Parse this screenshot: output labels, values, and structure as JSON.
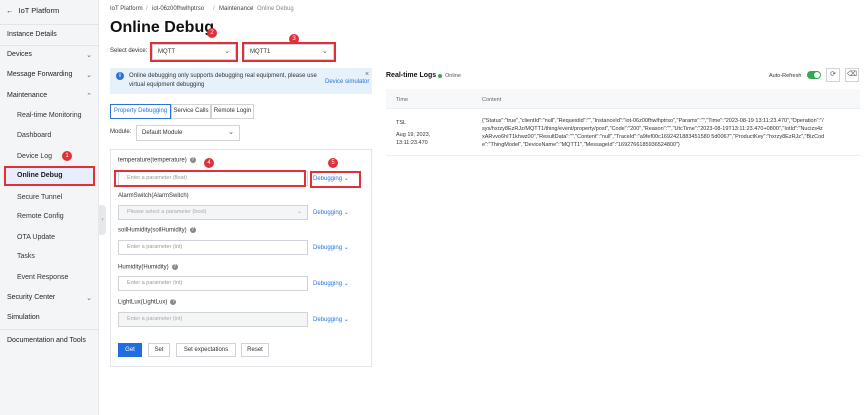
{
  "app": {
    "back_label": "IoT Platform"
  },
  "sidebar": {
    "items": [
      {
        "label": "Instance Details"
      },
      {
        "label": "Devices"
      },
      {
        "label": "Message Forwarding"
      },
      {
        "label": "Maintenance"
      },
      {
        "label": "Real-time Monitoring"
      },
      {
        "label": "Dashboard"
      },
      {
        "label": "Device Log"
      },
      {
        "label": "Online Debug"
      },
      {
        "label": "Secure Tunnel"
      },
      {
        "label": "Remote Config"
      },
      {
        "label": "OTA Update"
      },
      {
        "label": "Tasks"
      },
      {
        "label": "Event Response"
      },
      {
        "label": "Security Center"
      },
      {
        "label": "Simulation"
      },
      {
        "label": "Documentation and Tools"
      }
    ]
  },
  "breadcrumb": {
    "items": [
      "IoT Platform",
      "iot-06z00fhwlhptrso",
      "Maintenance",
      "Online Debug"
    ],
    "separator": "/"
  },
  "page": {
    "title": "Online Debug"
  },
  "device_select": {
    "label": "Select device:",
    "product": "MQTT",
    "device": "MQTT1"
  },
  "banner": {
    "message": "Online debugging only supports debugging real equipment, please use virtual equipment debugging",
    "link": "Device simulator"
  },
  "tabs": [
    "Property Debugging",
    "Service Calls",
    "Remote Login"
  ],
  "module": {
    "label": "Module:",
    "value": "Default Module"
  },
  "properties": [
    {
      "label": "temperature(temperature)",
      "placeholder": "Enter a parameter (float)",
      "action": "Debugging"
    },
    {
      "label": "AlarmSwitch(AlarmSwitch)",
      "placeholder": "Please select a parameter (bool)",
      "action": "Debugging"
    },
    {
      "label": "soilHumidity(soilHumidity)",
      "placeholder": "Enter a parameter (int)",
      "action": "Debugging"
    },
    {
      "label": "Humidity(Humidity)",
      "placeholder": "Enter a parameter (int)",
      "action": "Debugging"
    },
    {
      "label": "LightLux(LightLux)",
      "placeholder": "Enter a parameter (int)",
      "action": "Debugging"
    }
  ],
  "buttons": {
    "get": "Get",
    "set": "Set",
    "set_expectations": "Set expectations",
    "reset": "Reset"
  },
  "annotations": [
    "1",
    "2",
    "3",
    "4",
    "5"
  ],
  "logs": {
    "title": "Real-time Logs",
    "status": "Online",
    "auto_refresh": "Auto-Refresh",
    "auto_refresh_on": true,
    "columns": [
      "Time",
      "Content"
    ],
    "rows": [
      {
        "type": "TSL",
        "date": "Aug 19, 2023,",
        "time": "13:11:23.470",
        "content_lines": [
          "{\"Status\":\"true\",\"clientId\":\"null\",\"RequestId\":\"\",\"InstanceId\":\"iot-06z00fhwlhptrso\",\"Params\":\"\",\"Time\":\"2023-08-19 13:11:23.470\",\"Operation\":\"/",
          "sys/hxrzy8EzRJz/MQTT1/thing/event/property/post\",\"Code\":\"200\",\"Reason\":\"\",\"UtcTime\":\"2023-08-19T13:11:23.470+0800\",\"IotId\":\"Nucizs4z",
          "xARvvo6hIT1khwz00\",\"ResultData\":\"\",\"Content\":\"null\",\"TraceId\":\"a9fef00c1692421883451580 5d0067\",\"ProductKey\":\"hxrzy8EzRJz\",\"BizCod",
          "e\":\"ThingModel\",\"DeviceName\":\"MQTT1\",\"MessageId\":\"1692766185936524800\"}"
        ]
      }
    ]
  },
  "colors": {
    "accent": "#1f6de0",
    "highlight": "#e0303a",
    "online": "#2fa84f"
  }
}
